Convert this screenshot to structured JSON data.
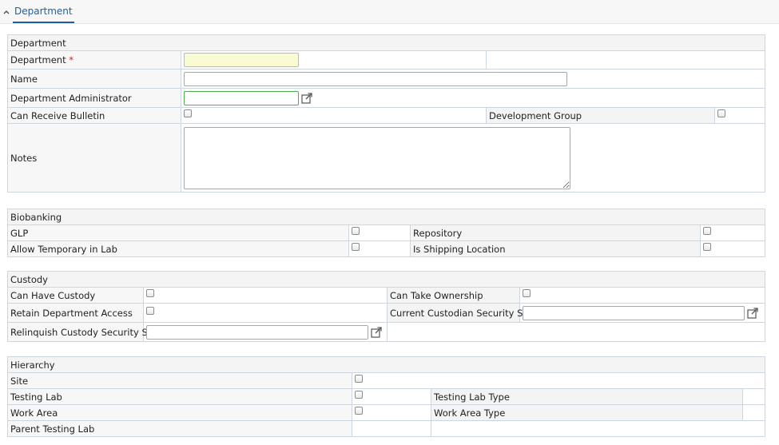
{
  "tab": {
    "label": "Department"
  },
  "department_section": {
    "header": "Department",
    "department_label": "Department",
    "required_mark": "*",
    "department_value": "",
    "name_label": "Name",
    "name_value": "",
    "admin_label": "Department Administrator",
    "admin_value": "",
    "bulletin_label": "Can Receive Bulletin",
    "dev_group_label": "Development Group",
    "notes_label": "Notes",
    "notes_value": ""
  },
  "biobanking_section": {
    "header": "Biobanking",
    "glp_label": "GLP",
    "repository_label": "Repository",
    "allow_temp_label": "Allow Temporary in Lab",
    "shipping_label": "Is Shipping Location"
  },
  "custody_section": {
    "header": "Custody",
    "can_have_label": "Can Have Custody",
    "take_ownership_label": "Can Take Ownership",
    "retain_label": "Retain Department Access",
    "current_custodian_label": "Current Custodian Security Set",
    "current_custodian_value": "",
    "relinquish_label": "Relinquish Custody Security Set",
    "relinquish_value": ""
  },
  "hierarchy_section": {
    "header": "Hierarchy",
    "site_label": "Site",
    "testing_lab_label": "Testing Lab",
    "testing_lab_type_label": "Testing Lab Type",
    "work_area_label": "Work Area",
    "work_area_type_label": "Work Area Type",
    "parent_lab_label": "Parent Testing Lab"
  },
  "icons": {
    "chevron": "chevron-up-icon",
    "lookup": "external-link-icon"
  }
}
